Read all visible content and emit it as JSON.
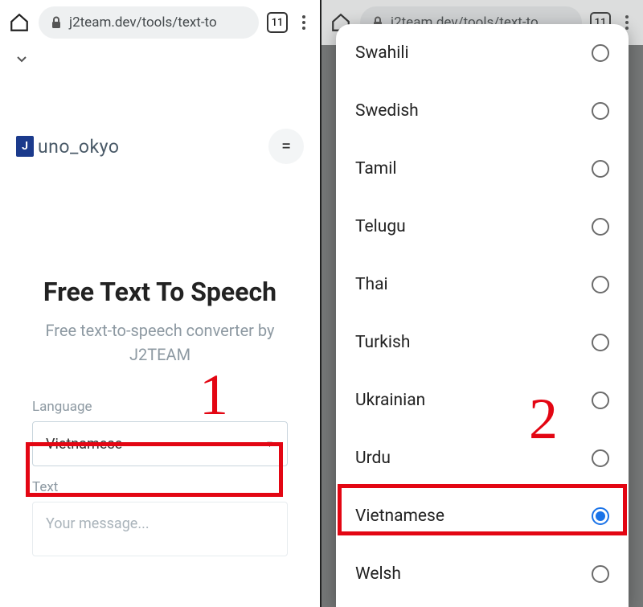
{
  "browser": {
    "url": "j2team.dev/tools/text-to",
    "tab_count": "11"
  },
  "site": {
    "brand": "uno_okyo"
  },
  "hero": {
    "title": "Free Text To Speech",
    "subtitle": "Free text-to-speech converter by J2TEAM"
  },
  "form": {
    "language_label": "Language",
    "language_value": "Vietnamese",
    "text_label": "Text",
    "text_placeholder": "Your message..."
  },
  "annotations": {
    "n1": "1",
    "n2": "2"
  },
  "options": [
    {
      "label": "Swahili",
      "selected": false
    },
    {
      "label": "Swedish",
      "selected": false
    },
    {
      "label": "Tamil",
      "selected": false
    },
    {
      "label": "Telugu",
      "selected": false
    },
    {
      "label": "Thai",
      "selected": false
    },
    {
      "label": "Turkish",
      "selected": false
    },
    {
      "label": "Ukrainian",
      "selected": false
    },
    {
      "label": "Urdu",
      "selected": false
    },
    {
      "label": "Vietnamese",
      "selected": true
    },
    {
      "label": "Welsh",
      "selected": false
    }
  ]
}
